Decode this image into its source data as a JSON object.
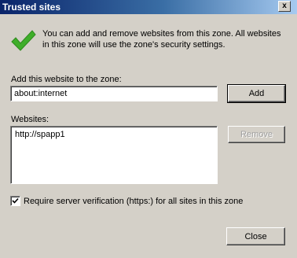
{
  "window": {
    "title": "Trusted sites",
    "close_glyph": "x"
  },
  "intro_text": "You can add and remove websites from this zone. All websites in this zone will use the zone's security settings.",
  "add_section": {
    "label": "Add this website to the zone:",
    "value": "about:internet",
    "add_button": "Add"
  },
  "websites_section": {
    "label": "Websites:",
    "items": [
      "http://spapp1"
    ],
    "remove_button": "Remove"
  },
  "https_checkbox": {
    "checked": true,
    "label": "Require server verification (https:) for all sites in this zone"
  },
  "close_button": "Close",
  "icons": {
    "check": "green-checkmark-icon"
  },
  "colors": {
    "dialog_bg": "#d4d0c8",
    "title_bar_start": "#0a246a",
    "title_bar_end": "#a6caf0",
    "checkmark_green": "#3fae2a"
  }
}
